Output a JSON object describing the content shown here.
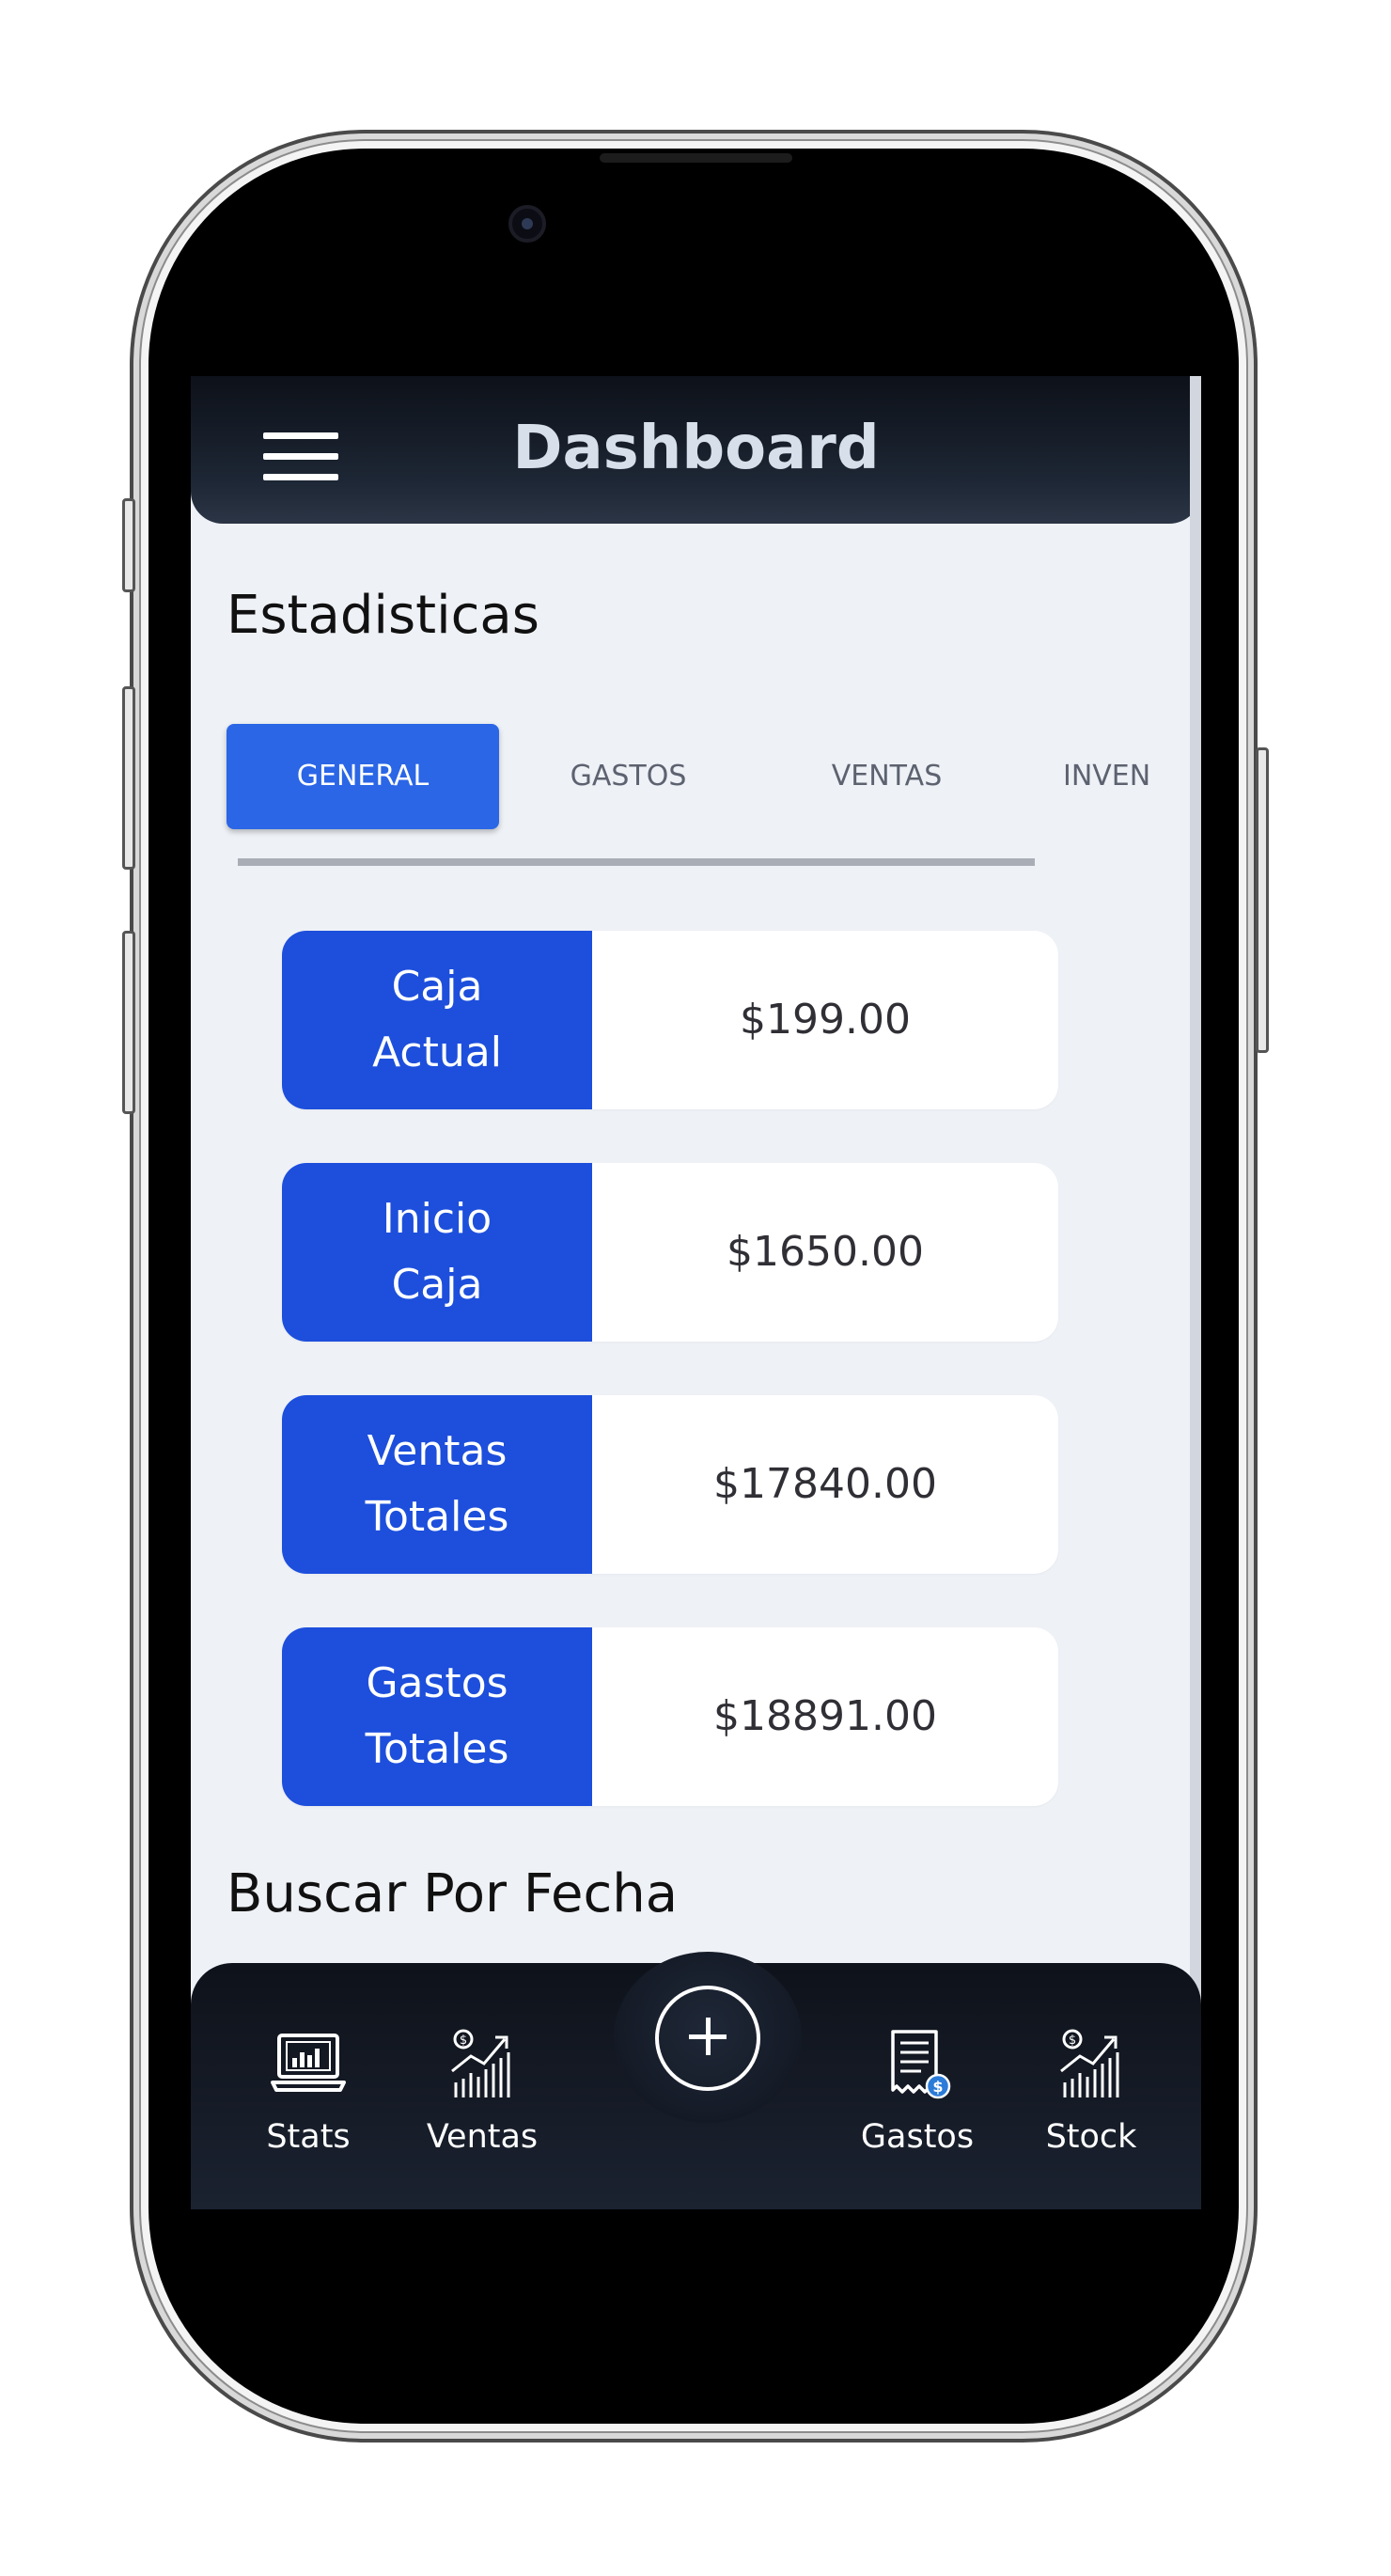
{
  "header": {
    "title": "Dashboard",
    "menu_icon": "hamburger-menu-icon"
  },
  "sections": {
    "stats_title": "Estadisticas",
    "search_title": "Buscar Por Fecha"
  },
  "tabs": [
    {
      "label": "GENERAL",
      "active": true
    },
    {
      "label": "GASTOS",
      "active": false
    },
    {
      "label": "VENTAS",
      "active": false
    },
    {
      "label": "INVEN",
      "active": false
    }
  ],
  "cards": [
    {
      "label": "Caja\nActual",
      "value": "$199.00"
    },
    {
      "label": "Inicio\nCaja",
      "value": "$1650.00"
    },
    {
      "label": "Ventas\nTotales",
      "value": "$17840.00"
    },
    {
      "label": "Gastos\nTotales",
      "value": "$18891.00"
    }
  ],
  "bottom_nav": {
    "items": [
      {
        "label": "Stats",
        "icon": "laptop-chart-icon"
      },
      {
        "label": "Ventas",
        "icon": "rising-chart-icon"
      },
      {
        "label": "Gastos",
        "icon": "receipt-dollar-icon"
      },
      {
        "label": "Stock",
        "icon": "rising-chart-icon"
      }
    ],
    "fab_icon": "plus-circle-icon"
  },
  "colors": {
    "accent": "#2a66e6",
    "card_label_bg": "#1d4fdc",
    "header_bg": "#131a25",
    "screen_bg": "#eef1f6"
  }
}
